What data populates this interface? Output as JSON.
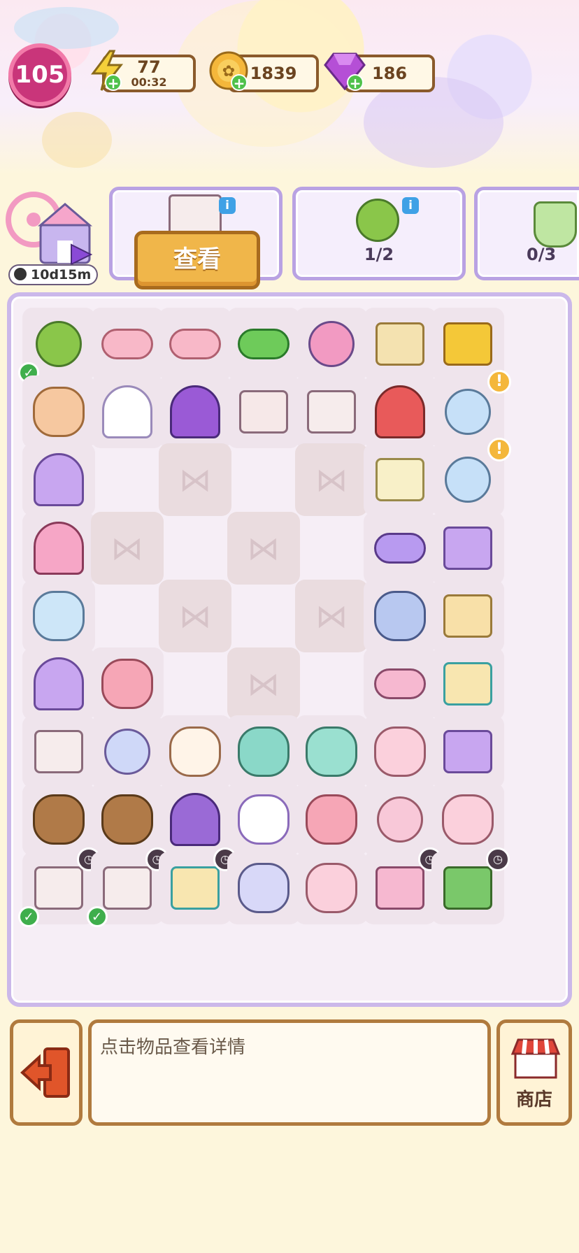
{
  "header": {
    "level": "105",
    "energy": {
      "value": "77",
      "timer": "00:32",
      "icon": "lightning-icon"
    },
    "coins": {
      "value": "1839",
      "icon": "coin-icon"
    },
    "gems": {
      "value": "186",
      "icon": "gem-icon"
    }
  },
  "event": {
    "timer": "10d15m",
    "icon": "amusement-park-icon"
  },
  "quests": [
    {
      "progress": "",
      "item": "cabinet-icon"
    },
    {
      "progress": "1/2",
      "item": "lollipop-icon"
    },
    {
      "progress": "0/3",
      "item": "drink-icon"
    }
  ],
  "view_button": "查看",
  "board": {
    "rows": [
      [
        "lollipop",
        "roll-cake",
        "roll-cake",
        "candy",
        "ferris-wheel",
        "tofu-block",
        "scroll-card"
      ],
      [
        "carousel-cups",
        "wedding-dress",
        "purple-skirt",
        "drawer",
        "cabinet-small",
        "carousel",
        "glass-jar"
      ],
      [
        "purple-gown",
        "empty",
        "locked",
        "empty",
        "locked",
        "ticket",
        "glass-jar"
      ],
      [
        "castle",
        "locked",
        "empty",
        "locked",
        "empty",
        "makeup-brushes",
        "blush-compact"
      ],
      [
        "candy-jar",
        "empty",
        "locked",
        "empty",
        "locked",
        "cosmetics",
        "foundation"
      ],
      [
        "purple-gown",
        "bunny-plush",
        "empty",
        "locked",
        "empty",
        "lint-roller",
        "gift-box"
      ],
      [
        "dresser",
        "hand-mirror",
        "puppy-plush",
        "elephant-plush",
        "seal-plush",
        "strawberry-drink",
        "blush-compact"
      ],
      [
        "teddy-bear",
        "teddy-bear",
        "purple-outfit",
        "unicorn-plush",
        "bunny-plush",
        "powder-puff",
        "strawberry-drink"
      ],
      [
        "dresser-tall",
        "dresser-tall",
        "gift-box",
        "energy-jar",
        "strawberry-drink",
        "pink-bed",
        "toy-house"
      ]
    ]
  },
  "info_panel": {
    "text": "点击物品查看详情"
  },
  "shop": {
    "label": "商店",
    "icon": "shop-awning-icon"
  },
  "exit": {
    "icon": "exit-door-icon"
  }
}
